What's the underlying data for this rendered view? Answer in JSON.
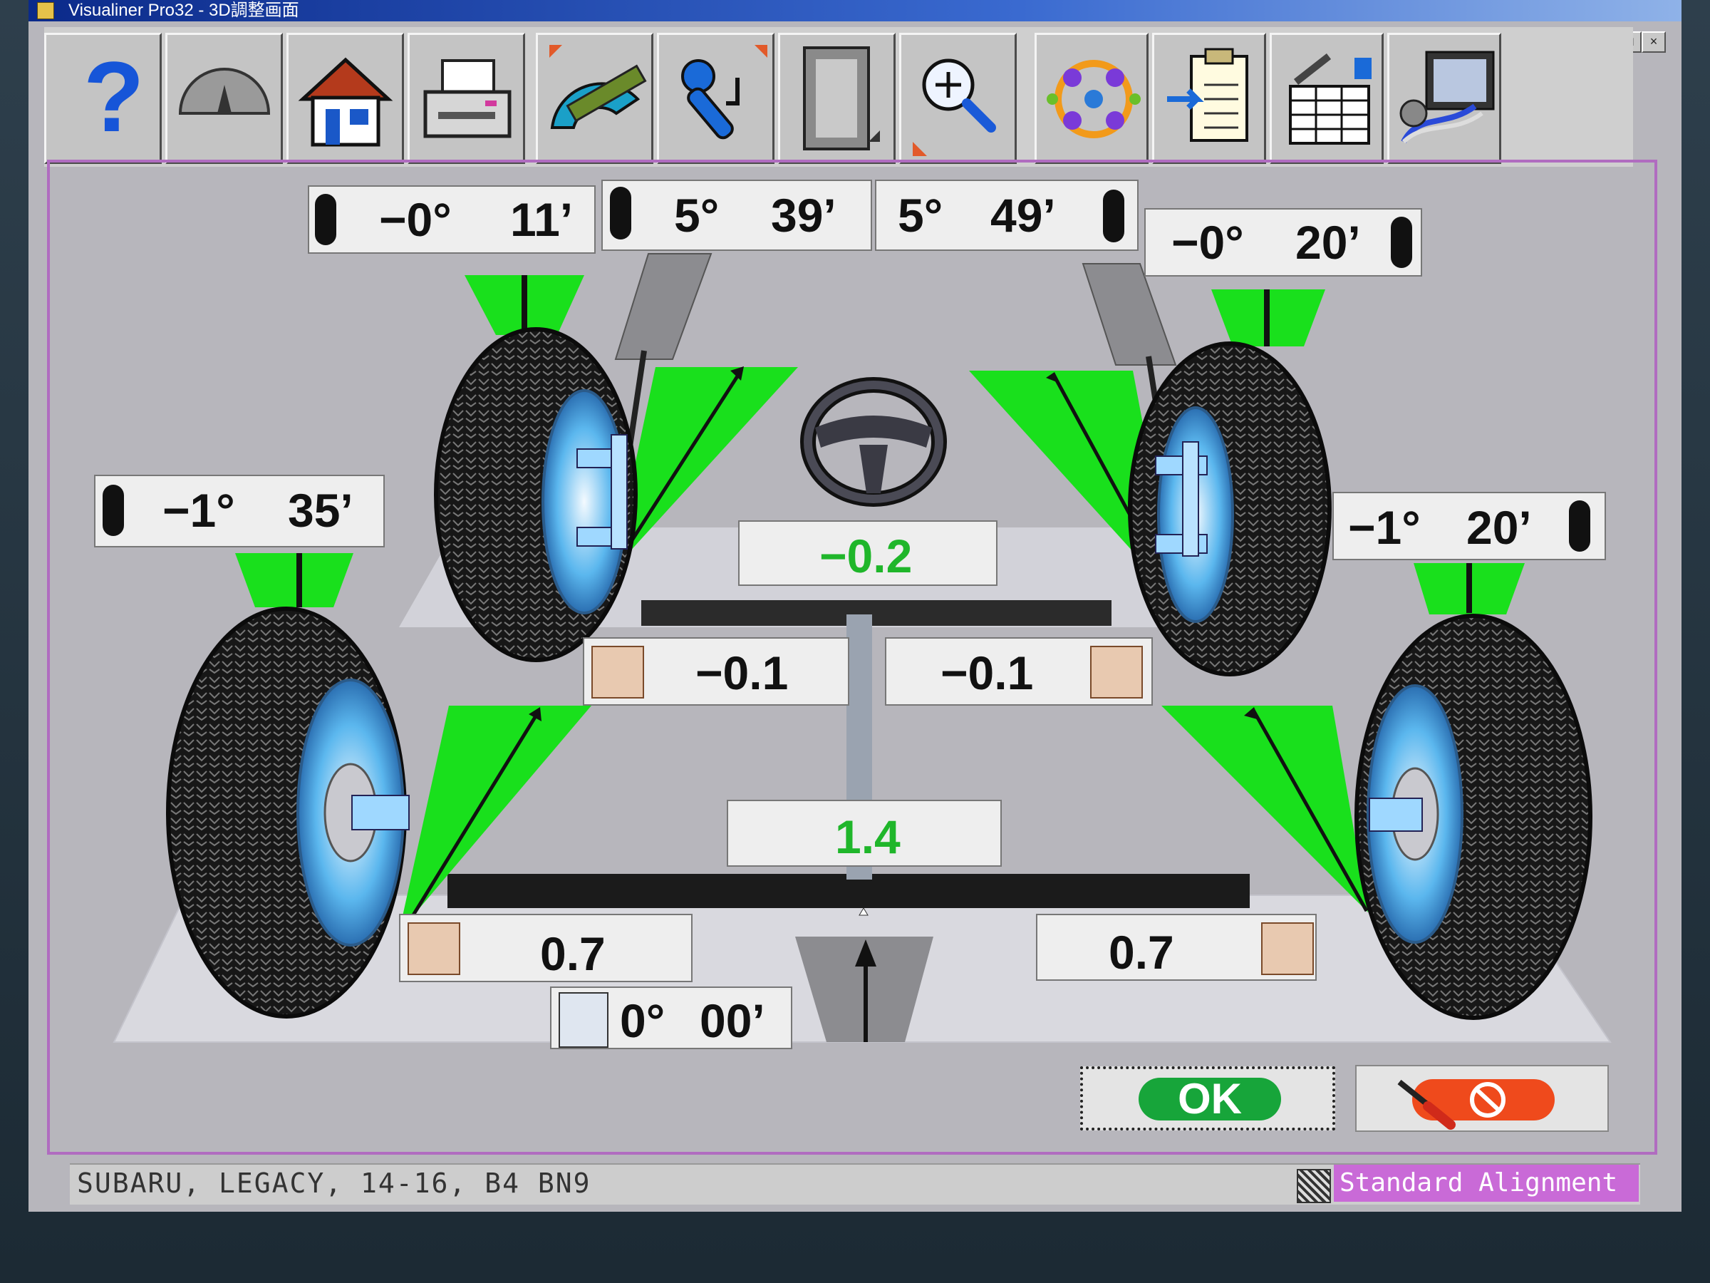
{
  "window": {
    "title": "Visualiner Pro32  -  3D調整画面",
    "controls": [
      "_",
      "□",
      "×"
    ]
  },
  "toolbar": {
    "buttons": [
      {
        "name": "help",
        "icon": "question-mark-icon"
      },
      {
        "name": "gauge",
        "icon": "gauge-icon"
      },
      {
        "name": "home",
        "icon": "home-icon"
      },
      {
        "name": "print",
        "icon": "printer-icon"
      },
      {
        "name": "measure",
        "icon": "protractor-ruler-icon"
      },
      {
        "name": "adjust",
        "icon": "wrench-icon"
      },
      {
        "name": "film",
        "icon": "film-strip-icon"
      },
      {
        "name": "zoom",
        "icon": "magnifier-icon"
      },
      {
        "name": "pattern",
        "icon": "dots-pattern-icon"
      },
      {
        "name": "clipboard",
        "icon": "clipboard-import-icon"
      },
      {
        "name": "spreadsheet",
        "icon": "spreadsheet-icon"
      },
      {
        "name": "hardware",
        "icon": "camera-hardware-icon"
      }
    ]
  },
  "readings": {
    "front_left_camber": {
      "deg": "−0°",
      "min": "11’"
    },
    "front_left_caster": {
      "deg": "5°",
      "min": "39’"
    },
    "front_right_caster": {
      "deg": "5°",
      "min": "49’"
    },
    "front_right_camber": {
      "deg": "−0°",
      "min": "20’"
    },
    "rear_left_camber": {
      "deg": "−1°",
      "min": "35’"
    },
    "rear_right_camber": {
      "deg": "−1°",
      "min": "20’"
    },
    "front_total_toe": "−0.2",
    "front_left_toe": "−0.1",
    "front_right_toe": "−0.1",
    "rear_total_toe": "1.4",
    "rear_left_toe": "0.7",
    "rear_right_toe": "0.7",
    "thrust_angle": {
      "deg": "0°",
      "min": "00’"
    }
  },
  "colors": {
    "in_spec": "#19e01c",
    "value_green": "#1fb62a",
    "ok": "#17a53a",
    "cancel": "#ef4a1c",
    "mode_bg": "#c96ad7",
    "frame": "#b06cc0"
  },
  "actions": {
    "ok_label": "OK",
    "cancel_icon": "cancel-icon"
  },
  "status": {
    "vehicle": "SUBARU, LEGACY, 14-16, B4 BN9",
    "mode": "Standard Alignment"
  }
}
